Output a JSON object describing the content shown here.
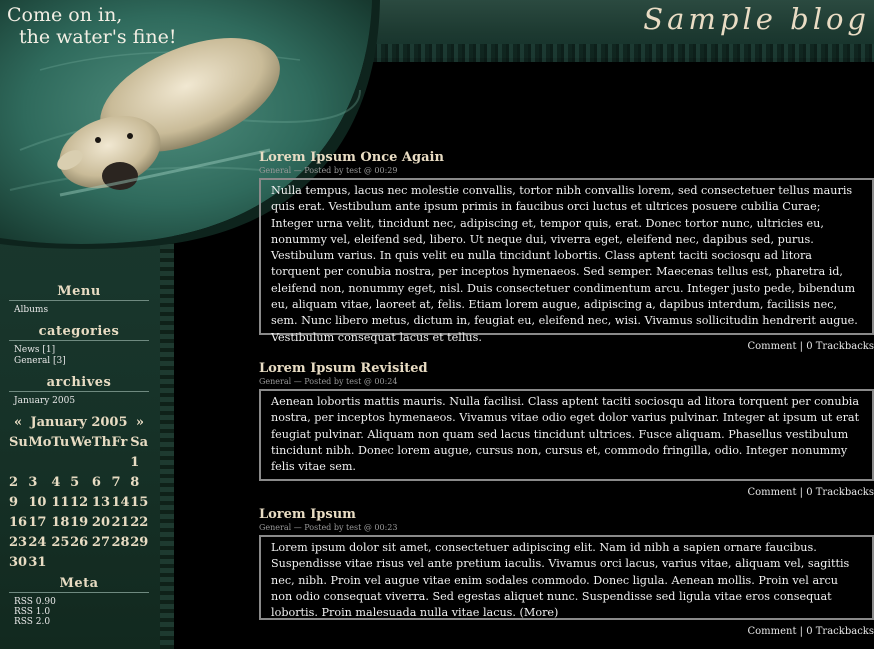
{
  "blog": {
    "title": "Sample blog",
    "slogan_line1": "Come on in,",
    "slogan_line2": "the water's fine!"
  },
  "sidebar": {
    "menu_heading": "Menu",
    "menu_items": [
      "Albums"
    ],
    "categories_heading": "categories",
    "categories": [
      "News [1]",
      "General [3]"
    ],
    "archives_heading": "archives",
    "archives": [
      "January 2005"
    ],
    "calendar": {
      "prev": "«",
      "next": "»",
      "month": "January 2005",
      "weekdays": [
        "Su",
        "Mo",
        "Tu",
        "We",
        "Th",
        "Fr",
        "Sa"
      ],
      "weeks": [
        [
          "",
          "",
          "",
          "",
          "",
          "",
          "1"
        ],
        [
          "2",
          "3",
          "4",
          "5",
          "6",
          "7",
          "8"
        ],
        [
          "9",
          "10",
          "11",
          "12",
          "13",
          "14",
          "15"
        ],
        [
          "16",
          "17",
          "18",
          "19",
          "20",
          "21",
          "22"
        ],
        [
          "23",
          "24",
          "25",
          "26",
          "27",
          "28",
          "29"
        ],
        [
          "30",
          "31",
          "",
          "",
          "",
          "",
          ""
        ]
      ]
    },
    "meta_heading": "Meta",
    "meta_items": [
      "RSS 0.90",
      "RSS 1.0",
      "RSS 2.0"
    ]
  },
  "posts": [
    {
      "title": "Lorem Ipsum Once Again",
      "meta": "General — Posted by test @ 00:29",
      "body": "Nulla tempus, lacus nec molestie convallis, tortor nibh convallis lorem, sed consectetuer tellus mauris quis erat. Vestibulum ante ipsum primis in faucibus orci luctus et ultrices posuere cubilia Curae; Integer urna velit, tincidunt nec, adipiscing et, tempor quis, erat. Donec tortor nunc, ultricies eu, nonummy vel, eleifend sed, libero. Ut neque dui, viverra eget, eleifend nec, dapibus sed, purus. Vestibulum varius. In quis velit eu nulla tincidunt lobortis. Class aptent taciti sociosqu ad litora torquent per conubia nostra, per inceptos hymenaeos. Sed semper. Maecenas tellus est, pharetra id, eleifend non, nonummy eget, nisl. Duis consectetuer condimentum arcu. Integer justo pede, bibendum eu, aliquam vitae, laoreet at, felis. Etiam lorem augue, adipiscing a, dapibus interdum, facilisis nec, sem. Nunc libero metus, dictum in, feugiat eu, eleifend nec, wisi. Vivamus sollicitudin hendrerit augue. Vestibulum consequat lacus et tellus.",
      "comment_label": "Comment",
      "trackbacks_label": "0 Trackbacks"
    },
    {
      "title": "Lorem Ipsum Revisited",
      "meta": "General — Posted by test @ 00:24",
      "body": "Aenean lobortis mattis mauris. Nulla facilisi. Class aptent taciti sociosqu ad litora torquent per conubia nostra, per inceptos hymenaeos. Vivamus vitae odio eget dolor varius pulvinar. Integer at ipsum ut erat feugiat pulvinar. Aliquam non quam sed lacus tincidunt ultrices. Fusce aliquam. Phasellus vestibulum tincidunt nibh. Donec lorem augue, cursus non, cursus et, commodo fringilla, odio. Integer nonummy felis vitae sem.",
      "comment_label": "Comment",
      "trackbacks_label": "0 Trackbacks"
    },
    {
      "title": "Lorem Ipsum",
      "meta": "General — Posted by test @ 00:23",
      "body": "Lorem ipsum dolor sit amet, consectetuer adipiscing elit. Nam id nibh a sapien ornare faucibus. Suspendisse vitae risus vel ante pretium iaculis. Vivamus orci lacus, varius vitae, aliquam vel, sagittis nec, nibh. Proin vel augue vitae enim sodales commodo. Donec ligula. Aenean mollis. Proin vel arcu non odio consequat viverra. Sed egestas aliquet nunc. Suspendisse sed ligula vitae eros consequat lobortis. Proin malesuada nulla vitae lacus.",
      "more_label": "(More)",
      "comment_label": "Comment",
      "trackbacks_label": "0 Trackbacks"
    }
  ],
  "colors": {
    "sidebar": "#1c3d33",
    "heading": "#e8dcc3",
    "border": "#8a8a8a"
  }
}
